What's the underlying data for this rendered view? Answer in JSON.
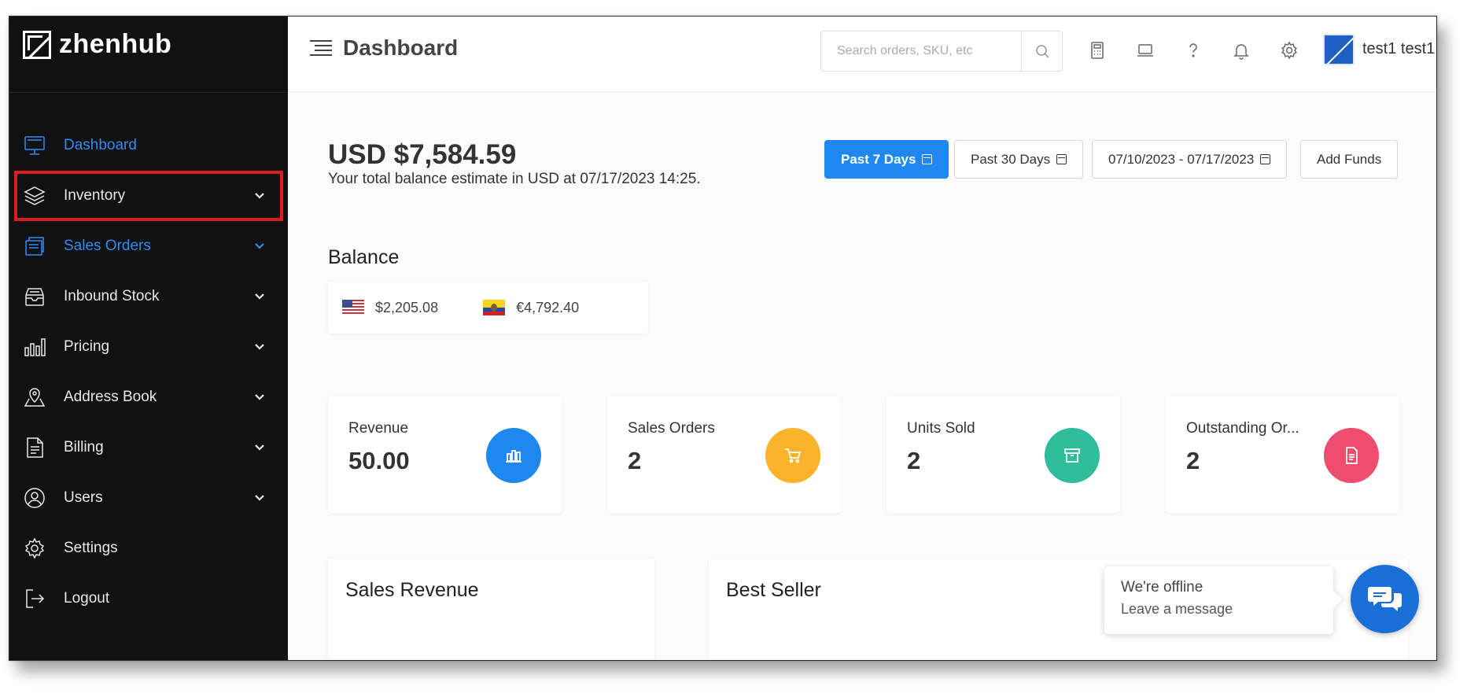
{
  "brand": {
    "name": "zhenhub"
  },
  "sidebar": {
    "items": [
      {
        "label": "Dashboard",
        "icon": "monitor-icon",
        "active": true,
        "expandable": false
      },
      {
        "label": "Inventory",
        "icon": "layers-icon",
        "active": false,
        "expandable": true,
        "highlighted": true
      },
      {
        "label": "Sales Orders",
        "icon": "folder-icon",
        "active": true,
        "expandable": true
      },
      {
        "label": "Inbound Stock",
        "icon": "inbox-icon",
        "active": false,
        "expandable": true
      },
      {
        "label": "Pricing",
        "icon": "bar-chart-icon",
        "active": false,
        "expandable": true
      },
      {
        "label": "Address Book",
        "icon": "map-pin-icon",
        "active": false,
        "expandable": true
      },
      {
        "label": "Billing",
        "icon": "document-icon",
        "active": false,
        "expandable": true
      },
      {
        "label": "Users",
        "icon": "user-icon",
        "active": false,
        "expandable": true
      },
      {
        "label": "Settings",
        "icon": "gear-icon",
        "active": false,
        "expandable": false
      },
      {
        "label": "Logout",
        "icon": "logout-icon",
        "active": false,
        "expandable": false
      }
    ]
  },
  "header": {
    "title": "Dashboard",
    "search": {
      "placeholder": "Search orders, SKU, etc",
      "value": ""
    },
    "icons": [
      "calculator-icon",
      "laptop-icon",
      "help-icon",
      "bell-icon",
      "gear-icon"
    ],
    "user_name": "test1 test1"
  },
  "summary": {
    "balance": "USD $7,584.59",
    "note": "Your total balance estimate in USD at 07/17/2023 14:25."
  },
  "range_buttons": {
    "past7": "Past 7 Days",
    "past30": "Past 30 Days",
    "custom": "07/10/2023 - 07/17/2023",
    "add_funds": "Add Funds"
  },
  "balance_section": {
    "title": "Balance",
    "items": [
      {
        "amount": "$2,205.08",
        "flag": "us-flag-icon"
      },
      {
        "amount": "€4,792.40",
        "flag": "ec-flag-icon"
      }
    ]
  },
  "stats": [
    {
      "label": "Revenue",
      "value": "50.00",
      "icon": "bar-chart-icon",
      "color": "#1e88f0"
    },
    {
      "label": "Sales Orders",
      "value": "2",
      "icon": "cart-icon",
      "color": "#fbb32b"
    },
    {
      "label": "Units Sold",
      "value": "2",
      "icon": "box-icon",
      "color": "#30bd9c"
    },
    {
      "label": "Outstanding Or...",
      "value": "2",
      "icon": "document-icon",
      "color": "#ef4d6e"
    }
  ],
  "panels": {
    "sales_revenue": "Sales Revenue",
    "best_seller": "Best Seller"
  },
  "chat": {
    "status": "We're offline",
    "action": "Leave a message"
  },
  "colors": {
    "accent": "#1e88f0",
    "sidebar_bg": "#111111",
    "highlight": "#e01b1b"
  }
}
